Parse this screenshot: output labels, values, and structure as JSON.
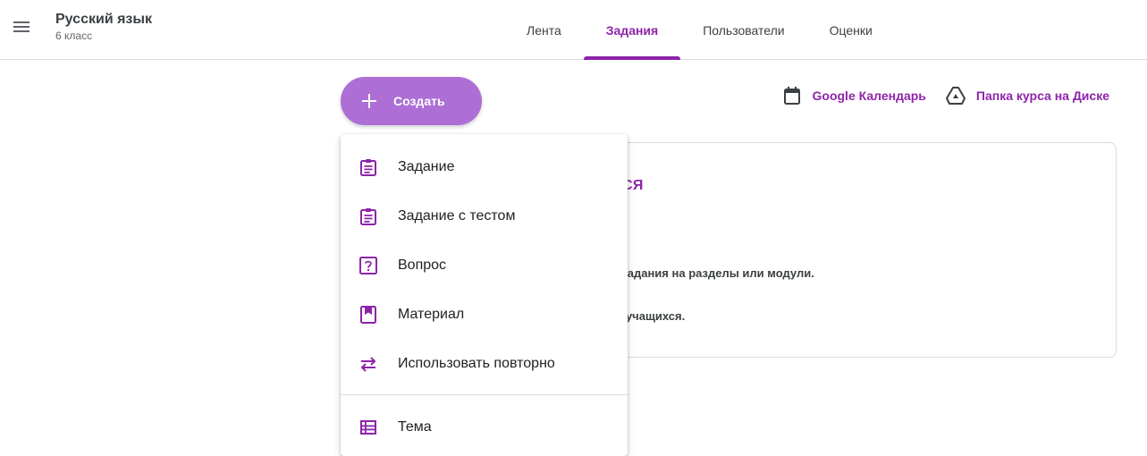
{
  "course": {
    "title": "Русский язык",
    "subtitle": "6 класс"
  },
  "tabs": [
    {
      "label": "Лента"
    },
    {
      "label": "Задания"
    },
    {
      "label": "Пользователи"
    },
    {
      "label": "Оценки"
    }
  ],
  "active_tab": "Задания",
  "create_button": {
    "label": "Создать"
  },
  "quick_links": {
    "calendar": "Google Календарь",
    "drive": "Папка курса на Диске"
  },
  "info_card": {
    "heading": "ЩИМСЯ",
    "line1": "елить задания на разделы или модули.",
    "line2": "са для учащихся."
  },
  "create_menu": {
    "items": [
      {
        "label": "Задание",
        "icon": "assignment-icon"
      },
      {
        "label": "Задание с тестом",
        "icon": "quiz-assignment-icon"
      },
      {
        "label": "Вопрос",
        "icon": "question-icon"
      },
      {
        "label": "Материал",
        "icon": "material-icon"
      },
      {
        "label": "Использовать повторно",
        "icon": "reuse-post-icon"
      },
      {
        "label": "Тема",
        "icon": "topic-icon"
      }
    ]
  },
  "colors": {
    "accent": "#8e24aa",
    "create_button_bg": "#ad6fd6",
    "divider": "#dadce0"
  }
}
